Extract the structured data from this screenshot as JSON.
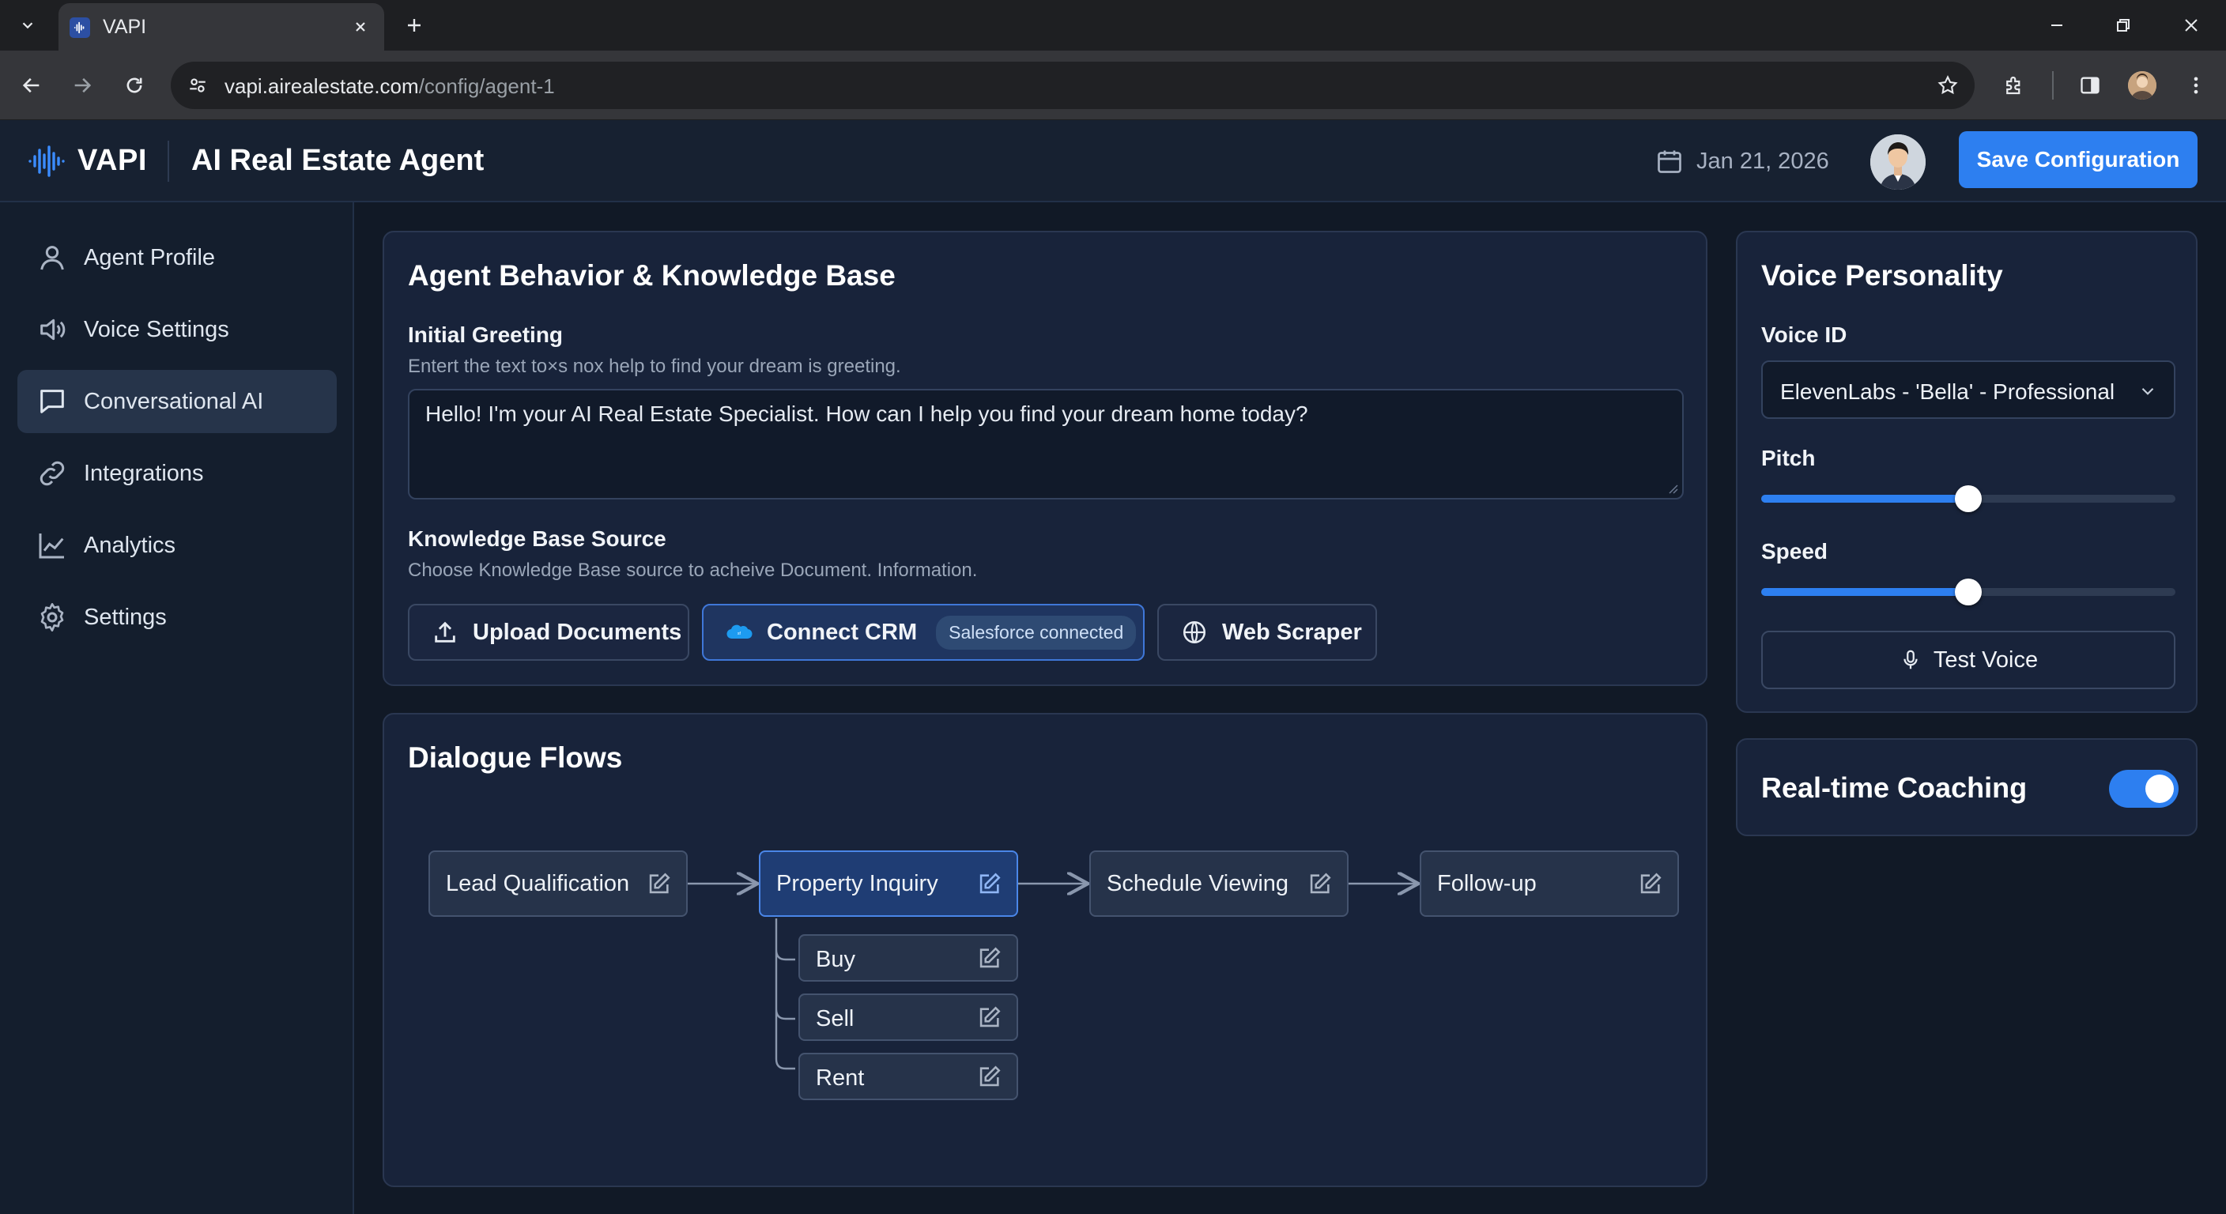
{
  "browser": {
    "tab_title": "VAPI",
    "url_host": "vapi.airealestate.com",
    "url_path": "/config/agent-1"
  },
  "header": {
    "logo_text": "VAPI",
    "title": "AI Real Estate Agent",
    "date": "Jan 21, 2026",
    "save_label": "Save Configuration"
  },
  "sidebar": {
    "items": [
      {
        "label": "Agent Profile",
        "icon": "user-icon"
      },
      {
        "label": "Voice Settings",
        "icon": "speaker-icon"
      },
      {
        "label": "Conversational AI",
        "icon": "chat-bubble-icon",
        "active": true
      },
      {
        "label": "Integrations",
        "icon": "link-icon"
      },
      {
        "label": "Analytics",
        "icon": "line-chart-icon"
      },
      {
        "label": "Settings",
        "icon": "gear-icon"
      }
    ]
  },
  "behavior": {
    "title": "Agent Behavior & Knowledge Base",
    "greeting_label": "Initial Greeting",
    "greeting_hint": "Entert the text to×s nox help to find your dream is greeting.",
    "greeting_value": "Hello! I'm your AI Real Estate Specialist. How can I help you find your dream home today?",
    "kb_label": "Knowledge Base Source",
    "kb_hint": "Choose Knowledge Base source to acheive Document. Information.",
    "sources": {
      "upload": "Upload Documents",
      "crm": "Connect CRM",
      "crm_status": "Salesforce connected",
      "scraper": "Web Scraper"
    }
  },
  "flows": {
    "title": "Dialogue Flows",
    "nodes": [
      "Lead Qualification",
      "Property Inquiry",
      "Schedule Viewing",
      "Follow-up"
    ],
    "sub_nodes": [
      "Buy",
      "Sell",
      "Rent"
    ]
  },
  "voice": {
    "title": "Voice Personality",
    "voice_id_label": "Voice ID",
    "voice_id_value": "ElevenLabs - 'Bella' - Professional",
    "pitch_label": "Pitch",
    "pitch_value": 0.5,
    "speed_label": "Speed",
    "speed_value": 0.5,
    "test_label": "Test Voice"
  },
  "coaching": {
    "label": "Real-time Coaching",
    "enabled": true
  },
  "colors": {
    "accent": "#2d7ff0",
    "background": "#111926",
    "card": "#18233a"
  }
}
